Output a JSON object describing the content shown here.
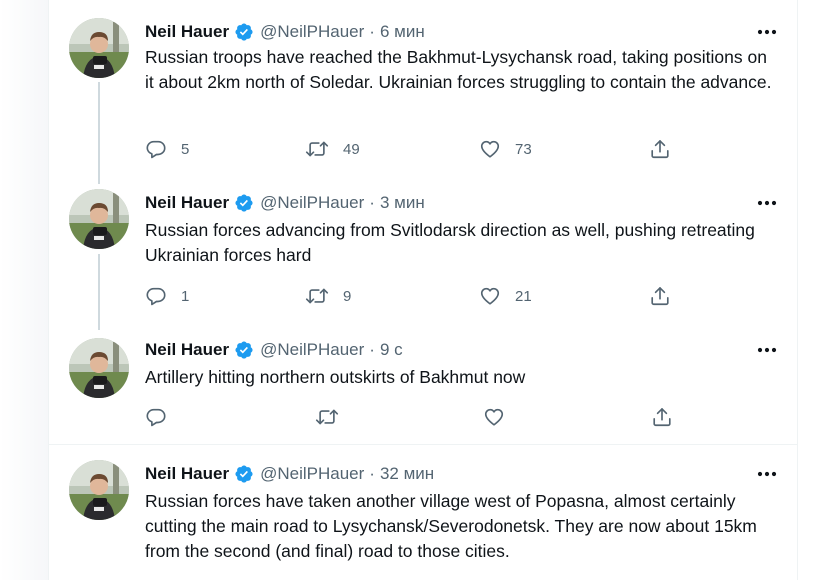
{
  "tweets": [
    {
      "name": "Neil Hauer",
      "handle": "@NeilPHauer",
      "separator": "·",
      "time": "6 мин",
      "text": "Russian troops have reached the Bakhmut-Lysychansk road, taking positions on it about 2km north of Soledar. Ukrainian forces struggling to contain the advance.",
      "replies": "5",
      "retweets": "49",
      "likes": "73"
    },
    {
      "name": "Neil Hauer",
      "handle": "@NeilPHauer",
      "separator": "·",
      "time": "3 мин",
      "text": "Russian forces advancing from Svitlodarsk direction as well, pushing retreating Ukrainian forces hard",
      "replies": "1",
      "retweets": "9",
      "likes": "21"
    },
    {
      "name": "Neil Hauer",
      "handle": "@NeilPHauer",
      "separator": "·",
      "time": "9 с",
      "text": "Artillery hitting northern outskirts of Bakhmut now",
      "replies": "",
      "retweets": "",
      "likes": ""
    },
    {
      "name": "Neil Hauer",
      "handle": "@NeilPHauer",
      "separator": "·",
      "time": "32 мин",
      "text": "Russian forces have taken another village west of Popasna, almost certainly cutting the main road to Lysychansk/Severodonetsk. They are now about 15km from the second (and final) road to those cities.",
      "replies": "",
      "retweets": "",
      "likes": ""
    }
  ],
  "icons": {
    "verified": "verified-badge-icon",
    "more": "more-options-icon",
    "reply": "reply-icon",
    "retweet": "retweet-icon",
    "like": "like-icon",
    "share": "share-icon"
  },
  "colors": {
    "verified": "#1d9bf0",
    "secondary_text": "#536471",
    "primary_text": "#0f1419",
    "thread_line": "#cfd9de",
    "divider": "#eff3f4"
  }
}
